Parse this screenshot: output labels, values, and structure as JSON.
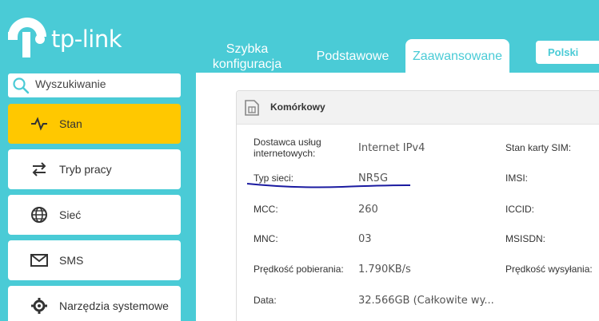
{
  "header": {
    "logo_text": "tp-link",
    "tabs": [
      {
        "label_line1": "Szybka",
        "label_line2": "konfiguracja"
      },
      {
        "label": "Podstawowe"
      },
      {
        "label": "Zaawansowane"
      }
    ],
    "language": "Polski"
  },
  "sidebar": {
    "search_placeholder": "Wyszukiwanie",
    "items": [
      {
        "label": "Stan",
        "icon": "pulse-icon",
        "active": true
      },
      {
        "label": "Tryb pracy",
        "icon": "swap-arrows-icon"
      },
      {
        "label": "Sieć",
        "icon": "globe-icon"
      },
      {
        "label": "SMS",
        "icon": "envelope-icon"
      },
      {
        "label": "Narzędzia systemowe",
        "icon": "gear-icon"
      }
    ]
  },
  "panel": {
    "title": "Komórkowy",
    "rows": [
      {
        "label_line1": "Dostawca usług",
        "label_line2": "internetowych:",
        "value": "Internet IPv4",
        "right_label": "Stan karty SIM:"
      },
      {
        "label": "Typ sieci:",
        "value": "NR5G",
        "right_label": "IMSI:"
      },
      {
        "label": "MCC:",
        "value": "260",
        "right_label": "ICCID:"
      },
      {
        "label": "MNC:",
        "value": "03",
        "right_label": "MSISDN:"
      },
      {
        "label": "Prędkość pobierania:",
        "value": "1.790KB/s",
        "right_label": "Prędkość wysyłania:"
      },
      {
        "label": "Data:",
        "value": "32.566GB (Całkowite wy..."
      }
    ]
  },
  "colors": {
    "accent": "#4acbd6",
    "active": "#ffc800",
    "annotation": "#1a1aa0"
  }
}
